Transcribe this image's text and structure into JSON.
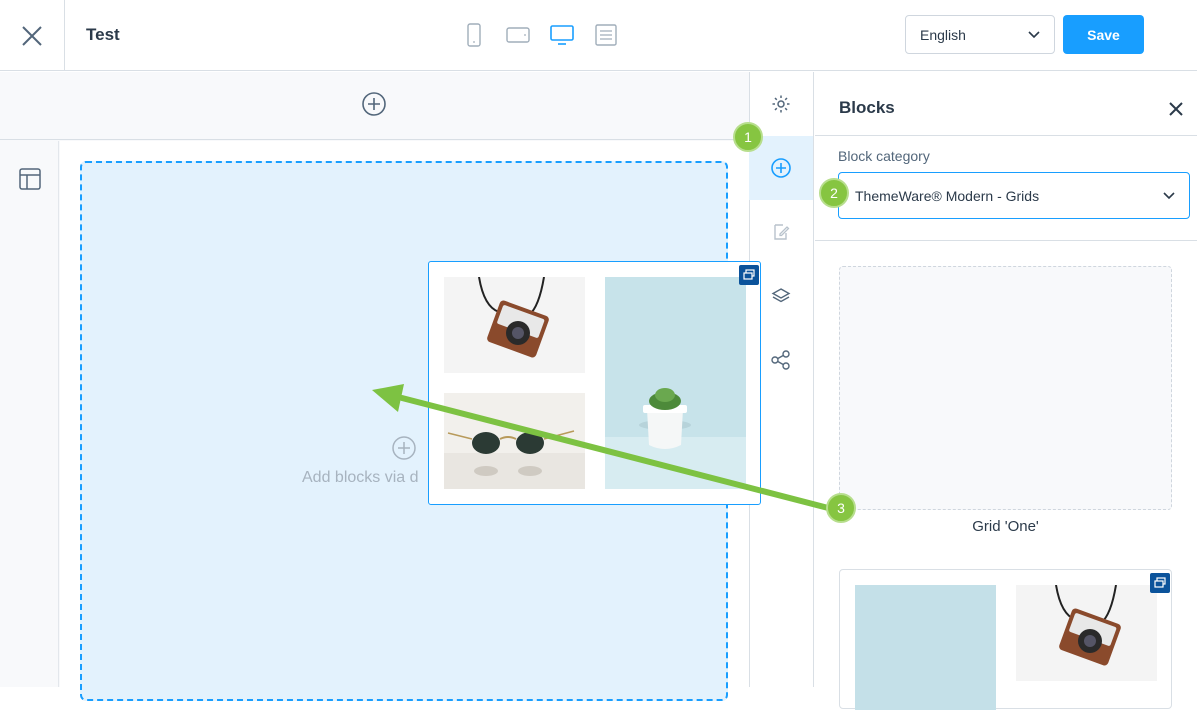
{
  "header": {
    "title": "Test",
    "language": "English",
    "save_label": "Save",
    "devices": [
      "mobile-icon",
      "tablet-icon",
      "desktop-icon",
      "form-icon"
    ]
  },
  "canvas": {
    "drop_text": "Add blocks via d"
  },
  "sidebar": {
    "icons": [
      "gear-icon",
      "add-icon",
      "edit-icon",
      "layers-icon",
      "share-icon"
    ]
  },
  "blocks_panel": {
    "title": "Blocks",
    "category_label": "Block category",
    "category_value": "ThemeWare® Modern - Grids",
    "preview_label": "Grid 'One'"
  },
  "steps": [
    "1",
    "2",
    "3"
  ],
  "colors": {
    "accent": "#189eff",
    "dropzone_bg": "#e3f2fd",
    "step_green": "#86c541",
    "arrow_green": "#7dc242",
    "badge_blue": "#0b539b"
  }
}
